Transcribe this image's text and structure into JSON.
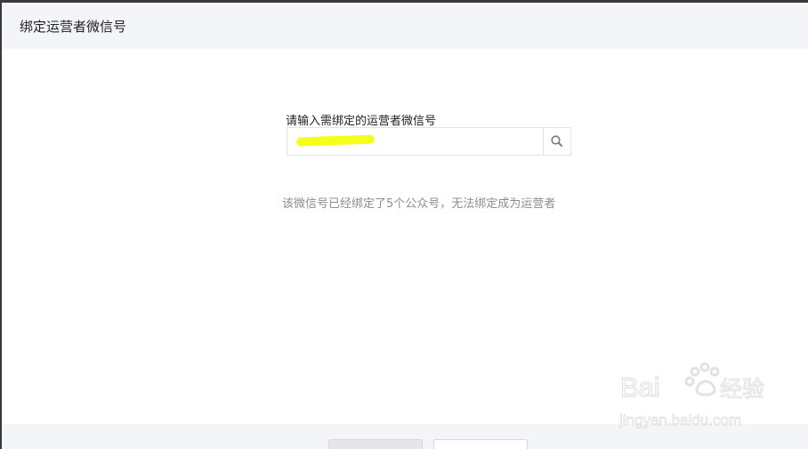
{
  "dialog": {
    "title": "绑定运营者微信号"
  },
  "search": {
    "label": "请输入需绑定的运营者微信号",
    "value": "",
    "icon": "search-icon"
  },
  "status": {
    "message": "该微信号已经绑定了5个公众号，无法绑定成为运营者"
  },
  "footer": {
    "primary_label": "",
    "secondary_label": ""
  },
  "watermark": {
    "brand": "Baidu经验",
    "url": "jingyan.baidu.com"
  },
  "colors": {
    "header_bg": "#f4f5f9",
    "status_text": "#8d8d8d",
    "highlight": "#f6ff1a"
  }
}
